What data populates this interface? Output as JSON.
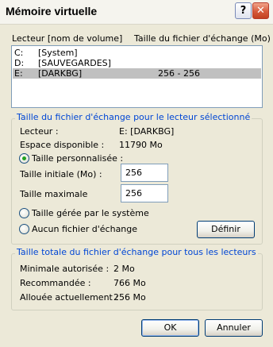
{
  "window": {
    "title": "Mémoire virtuelle",
    "help_glyph": "?",
    "close_glyph": "✕"
  },
  "drives": {
    "header_drive": "Lecteur  [nom de volume]",
    "header_size": "Taille du fichier d'échange (Mo)",
    "rows": [
      {
        "letter": "C:",
        "label": "[System]",
        "size": "",
        "selected": false
      },
      {
        "letter": "D:",
        "label": "[SAUVEGARDES]",
        "size": "",
        "selected": false
      },
      {
        "letter": "E:",
        "label": "[DARKBG]",
        "size": "256 - 256",
        "selected": true
      }
    ]
  },
  "selected_drive": {
    "group_title": "Taille du fichier d'échange pour le lecteur sélectionné",
    "drive_label": "Lecteur :",
    "drive_value": "E:  [DARKBG]",
    "space_label": "Espace disponible :",
    "space_value": "11790 Mo",
    "custom_size_label": "Taille personnalisée :",
    "initial_label": "Taille initiale (Mo) :",
    "initial_value": "256",
    "max_label": "Taille maximale",
    "max_value": "256",
    "system_managed_label": "Taille gérée par le système",
    "no_paging_label": "Aucun fichier d'échange",
    "set_button": "Définir",
    "selected_option": "custom"
  },
  "total": {
    "group_title": "Taille totale du fichier d'échange pour tous les lecteurs",
    "min_label": "Minimale autorisée :",
    "min_value": "2 Mo",
    "recommended_label": "Recommandée :",
    "recommended_value": "766 Mo",
    "allocated_label": "Allouée actuellement :",
    "allocated_value": "256 Mo"
  },
  "buttons": {
    "ok": "OK",
    "cancel": "Annuler"
  },
  "colors": {
    "group_title": "#0046d5",
    "selection": "#c0c0c0",
    "face": "#ece9d8"
  }
}
